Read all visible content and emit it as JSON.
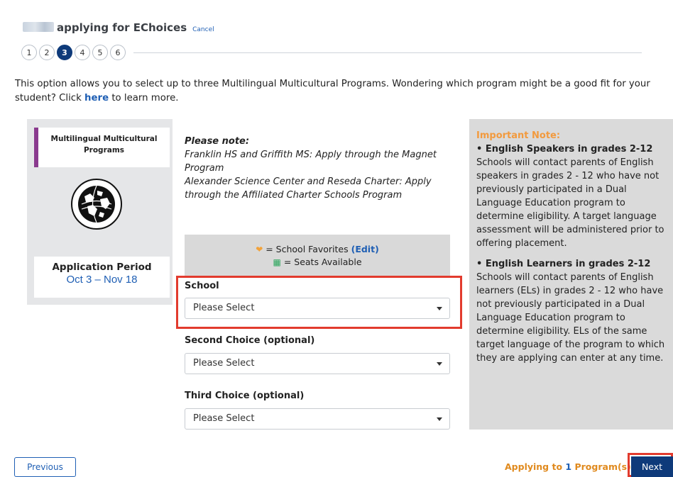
{
  "header": {
    "title": "applying for EChoices",
    "cancel_label": "Cancel"
  },
  "steps": [
    "1",
    "2",
    "3",
    "4",
    "5",
    "6"
  ],
  "active_step": "3",
  "intro": {
    "text_before": "This option allows you to select up to three Multilingual Multicultural Programs. Wondering which program might be a good fit for your student? Click ",
    "link": "here",
    "text_after": " to learn more."
  },
  "program": {
    "name": "Multilingual Multicultural Programs",
    "application_period_label": "Application Period",
    "application_period_dates": "Oct 3 – Nov 18"
  },
  "note": {
    "title": "Please note:",
    "line1": "Franklin HS and Griffith MS: Apply through the Magnet Program",
    "line2": "Alexander Science Center and Reseda Charter: Apply through the Affiliated Charter Schools Program"
  },
  "legend": {
    "favorites_text": "= School Favorites",
    "edit_label": "(Edit)",
    "seats_text": "= Seats Available"
  },
  "fields": {
    "school_label": "School",
    "school_value": "Please Select",
    "second_label": "Second Choice (optional)",
    "second_value": "Please Select",
    "third_label": "Third Choice (optional)",
    "third_value": "Please Select"
  },
  "important": {
    "title": "Important Note:",
    "b1_title": "• English Speakers in grades 2-12",
    "b1_text": "Schools will contact parents of English speakers in grades 2 - 12 who have not previously participated in a Dual Language Education program to determine eligibility. A target language assessment will be administered prior to offering placement.",
    "b2_title": "• English Learners in grades 2-12",
    "b2_text": "Schools will contact parents of English learners (ELs) in grades 2 - 12 who have not previously participated in a Dual Language Education program to determine eligibility. ELs of the same target language of the program to which they are applying can enter at any time."
  },
  "footer": {
    "previous_label": "Previous",
    "applying_prefix": "Applying to",
    "applying_count": "1",
    "applying_suffix": "Program(s)",
    "next_label": "Next"
  },
  "colors": {
    "brand_blue": "#0e3a7a",
    "link_blue": "#1f5fb4",
    "accent_orange": "#f29a3e",
    "highlight_red": "#e23b2e",
    "program_purple": "#8a3a8e"
  }
}
